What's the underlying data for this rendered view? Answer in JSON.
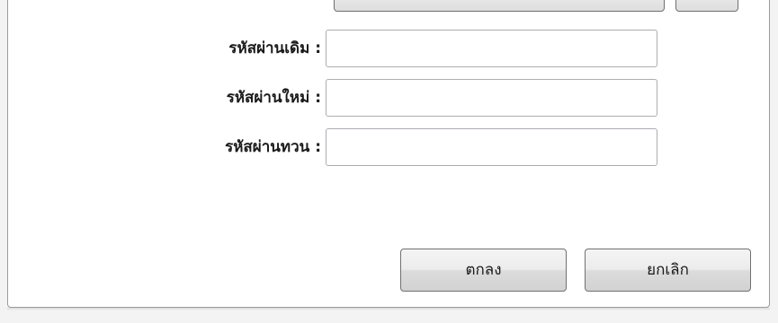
{
  "form": {
    "fields": [
      {
        "label": "รหัสผ่านเดิม :",
        "value": "",
        "placeholder": ""
      },
      {
        "label": "รหัสผ่านใหม่ :",
        "value": "",
        "placeholder": ""
      },
      {
        "label": "รหัสผ่านทวน :",
        "value": "",
        "placeholder": ""
      }
    ]
  },
  "buttons": {
    "ok_label": "ตกลง",
    "cancel_label": "ยกเลิก"
  },
  "colors": {
    "panel_bg": "#ffffff",
    "frame_bg": "#f3f3f3",
    "border": "#9a9a9a"
  }
}
